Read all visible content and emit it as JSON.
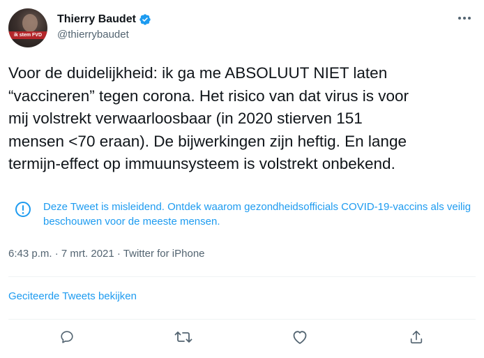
{
  "author": {
    "display_name": "Thierry Baudet",
    "handle": "@thierrybaudet",
    "avatar_ribbon": "ik stem FVD"
  },
  "tweet": {
    "text": "Voor de duidelijkheid: ik ga me ABSOLUUT NIET laten\n“vaccineren” tegen corona. Het risico van dat virus is voor\nmij volstrekt verwaarloosbaar (in 2020 stierven 151\nmensen <70 eraan). De bijwerkingen zijn heftig. En lange\ntermijn-effect op immuunsysteem is volstrekt onbekend."
  },
  "notice": {
    "text": "Deze Tweet is misleidend. Ontdek waarom gezondheidsofficials COVID-19-vaccins als veilig beschouwen voor de meeste mensen.",
    "icon": "exclamation-circle-icon"
  },
  "meta": {
    "line": "6:43 p.m. · 7 mrt. 2021 · Twitter for iPhone"
  },
  "links": {
    "quoted_tweets": "Geciteerde Tweets bekijken"
  },
  "actions": [
    "reply-icon",
    "retweet-icon",
    "like-icon",
    "share-icon"
  ],
  "colors": {
    "accent": "#1d9bf0",
    "secondary_text": "#536471",
    "verified": "#1d9bf0"
  }
}
